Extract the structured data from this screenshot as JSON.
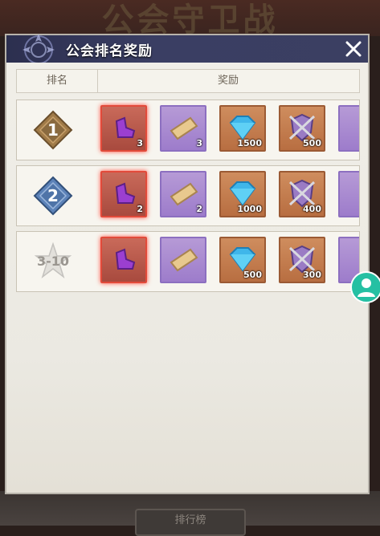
{
  "background": {
    "title": "公会守卫战",
    "button_label": "排行榜"
  },
  "panel": {
    "title": "公会排名奖励"
  },
  "table": {
    "col_rank": "排名",
    "col_reward": "奖励"
  },
  "rows": [
    {
      "rank": "1",
      "rewards": [
        {
          "icon": "shoe-icon",
          "quality": "red",
          "qty": "3"
        },
        {
          "icon": "scroll-icon",
          "quality": "purple",
          "qty": "3"
        },
        {
          "icon": "diamond-icon",
          "quality": "orange",
          "qty": "1500"
        },
        {
          "icon": "shield-swords-icon",
          "quality": "orange",
          "qty": "500"
        },
        {
          "icon": "partial-item",
          "quality": "purple",
          "qty": ""
        }
      ]
    },
    {
      "rank": "2",
      "rewards": [
        {
          "icon": "shoe-icon",
          "quality": "red",
          "qty": "2"
        },
        {
          "icon": "scroll-icon",
          "quality": "purple",
          "qty": "2"
        },
        {
          "icon": "diamond-icon",
          "quality": "orange",
          "qty": "1000"
        },
        {
          "icon": "shield-swords-icon",
          "quality": "orange",
          "qty": "400"
        },
        {
          "icon": "partial-item",
          "quality": "purple",
          "qty": ""
        }
      ]
    },
    {
      "rank": "3-10",
      "rewards": [
        {
          "icon": "shoe-icon",
          "quality": "red",
          "qty": ""
        },
        {
          "icon": "scroll-icon",
          "quality": "purple",
          "qty": ""
        },
        {
          "icon": "diamond-icon",
          "quality": "orange",
          "qty": "500"
        },
        {
          "icon": "shield-swords-icon",
          "quality": "orange",
          "qty": "300"
        },
        {
          "icon": "partial-item",
          "quality": "purple",
          "qty": ""
        }
      ]
    }
  ],
  "colors": {
    "header": "#2c2f4f",
    "gold": "#8a6a3f",
    "silver_blue": "#4f74a8",
    "grey": "#c4c2be",
    "fab": "#25c0a3"
  }
}
